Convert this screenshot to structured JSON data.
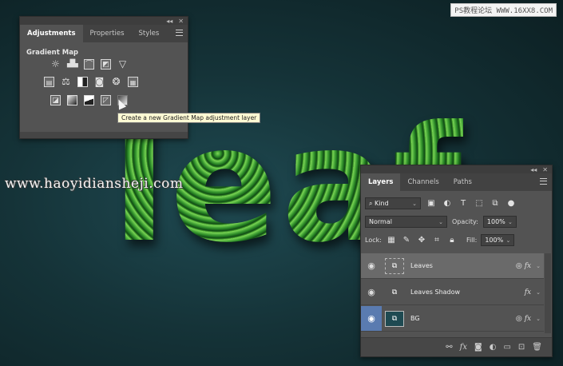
{
  "watermarks": {
    "top": "PS教程论坛 WWW.16XX8.COM",
    "middle": "www.haoyidiansheji.com"
  },
  "artwork": {
    "leaf_text": "leaf"
  },
  "adjustments_panel": {
    "tabs": [
      {
        "label": "Adjustments",
        "active": true
      },
      {
        "label": "Properties",
        "active": false
      },
      {
        "label": "Styles",
        "active": false
      }
    ],
    "section_title": "Gradient Map",
    "rows": [
      [
        "brightness-contrast-icon",
        "levels-icon",
        "curves-icon",
        "exposure-icon",
        "vibrance-icon"
      ],
      [
        "hue-saturation-icon",
        "color-balance-icon",
        "black-white-icon",
        "photo-filter-icon",
        "channel-mixer-icon",
        "color-lookup-icon"
      ],
      [
        "invert-icon",
        "posterize-icon",
        "threshold-icon",
        "selective-color-icon",
        "gradient-map-icon"
      ]
    ],
    "tooltip": "Create a new Gradient Map adjustment layer"
  },
  "layers_panel": {
    "tabs": [
      {
        "label": "Layers",
        "active": true
      },
      {
        "label": "Channels",
        "active": false
      },
      {
        "label": "Paths",
        "active": false
      }
    ],
    "filter_kind": "Kind",
    "blend_mode": "Normal",
    "opacity_label": "Opacity:",
    "opacity_value": "100%",
    "lock_label": "Lock:",
    "fill_label": "Fill:",
    "fill_value": "100%",
    "layers": [
      {
        "name": "Leaves",
        "selected": true,
        "fx": "fx",
        "thumb": "group"
      },
      {
        "name": "Leaves Shadow",
        "selected": false,
        "fx": "fx",
        "thumb": "smart"
      },
      {
        "name": "BG",
        "selected": false,
        "fx": "fx",
        "thumb": "bg"
      }
    ],
    "bottom_icons": [
      "link-icon",
      "fx-icon",
      "mask-icon",
      "adjustment-icon",
      "folder-icon",
      "new-layer-icon",
      "trash-icon"
    ]
  }
}
